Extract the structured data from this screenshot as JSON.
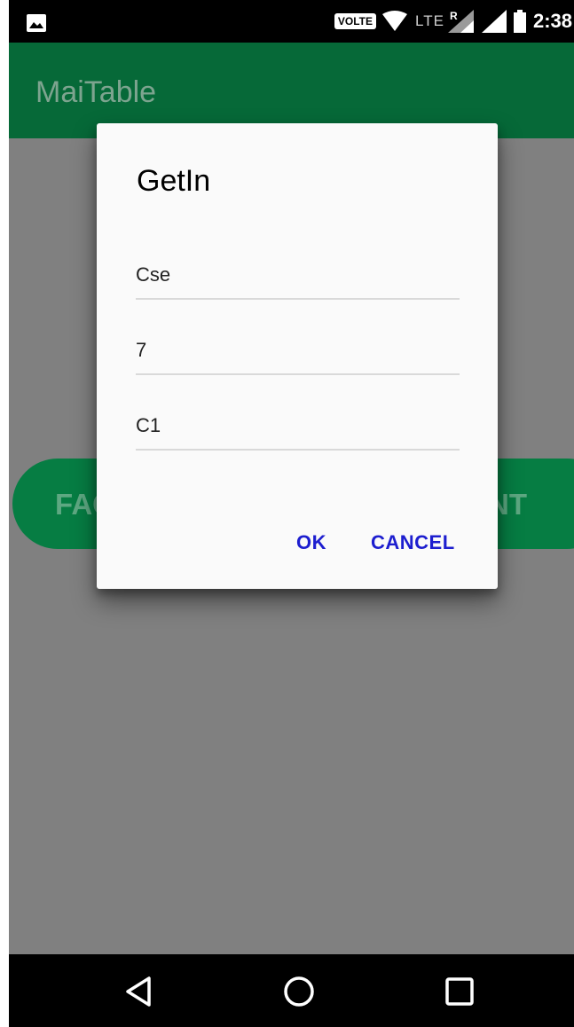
{
  "status_bar": {
    "volte": "VOLTE",
    "lte": "LTE",
    "roaming": "R",
    "time": "2:38",
    "icons": [
      "gallery-icon",
      "wifi-icon",
      "signal-roaming-icon",
      "signal-icon",
      "battery-icon"
    ]
  },
  "app_bar": {
    "title": "MaiTable",
    "color": "#066938"
  },
  "background": {
    "left_button_label": "FAC",
    "right_button_label": "NT",
    "button_color": "#067d43",
    "scrim_color": "#808080"
  },
  "dialog": {
    "title": "GetIn",
    "fields": [
      {
        "value": "Cse"
      },
      {
        "value": "7"
      },
      {
        "value": "C1"
      }
    ],
    "ok_label": "OK",
    "cancel_label": "CANCEL",
    "button_color": "#1d1ecf"
  },
  "nav_bar": {
    "icons": [
      "back-icon",
      "home-icon",
      "recents-icon"
    ]
  }
}
